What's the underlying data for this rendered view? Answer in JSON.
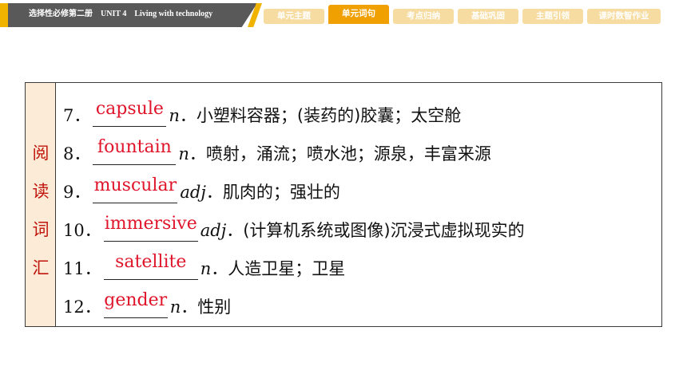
{
  "header": {
    "title": "选择性必修第二册　UNIT 4　Living with technology",
    "tabs": [
      {
        "label": "单元主题",
        "active": false
      },
      {
        "label": "单元词句",
        "active": true
      },
      {
        "label": "考点归纳",
        "active": false
      },
      {
        "label": "基础巩固",
        "active": false
      },
      {
        "label": "主题引领",
        "active": false
      },
      {
        "label": "课时数智作业",
        "active": false
      }
    ]
  },
  "side_label": [
    "阅",
    "读",
    "词",
    "汇"
  ],
  "items": [
    {
      "num": "7．",
      "answer": "capsule",
      "pos": "n",
      "sep": "．",
      "meaning": "小塑料容器；(装药的)胶囊；太空舱"
    },
    {
      "num": "8．",
      "answer": "fountain",
      "pos": "n",
      "sep": "．",
      "meaning": "喷射，涌流；喷水池；源泉，丰富来源"
    },
    {
      "num": "9．",
      "answer": "muscular",
      "pos": "adj",
      "sep": "．",
      "meaning": "肌肉的；强壮的"
    },
    {
      "num": "10．",
      "answer": "immersive",
      "pos": "adj",
      "sep": "．",
      "meaning": "(计算机系统或图像)沉浸式虚拟现实的"
    },
    {
      "num": "11．",
      "answer": "satellite",
      "pos": "n",
      "sep": "．",
      "meaning": "人造卫星；卫星"
    },
    {
      "num": "12．",
      "answer": "gender",
      "pos": "n",
      "sep": "．",
      "meaning": "性别"
    }
  ],
  "colors": {
    "accent": "#f0a000",
    "answer": "#e0142a",
    "side_bg": "#fcebd6",
    "banner": "#595959"
  }
}
